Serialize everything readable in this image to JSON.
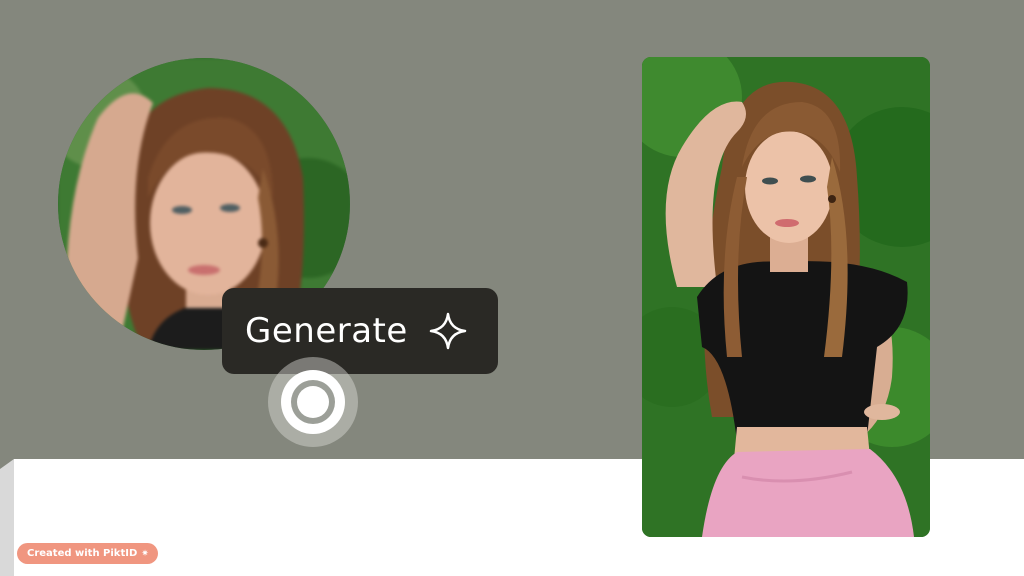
{
  "generate_button": {
    "label": "Generate",
    "icon": "sparkle-icon"
  },
  "watermark": {
    "text": "Created with PiktID",
    "icon": "sparkle-small-icon",
    "icon_glyph": "✷"
  },
  "colors": {
    "background_band": "#84877d",
    "button_bg": "#2a2925",
    "badge_bg": "#f09680"
  }
}
